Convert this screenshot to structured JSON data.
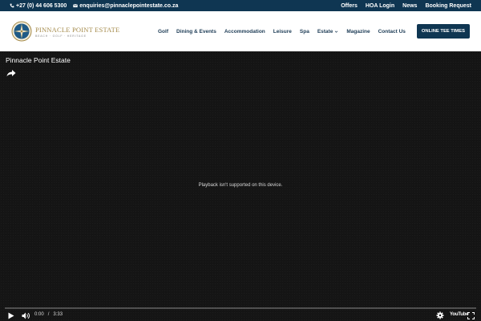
{
  "topbar": {
    "phone": "+27 (0) 44 606 5300",
    "email": "enquiries@pinnaclepointestate.co.za",
    "links": [
      "Offers",
      "HOA Login",
      "News",
      "Booking Request"
    ]
  },
  "header": {
    "logo_name": "PINNACLE POINT ESTATE",
    "logo_tagline": "BEACH · GOLF · HERITAGE",
    "nav": [
      "Golf",
      "Dining & Events",
      "Accommodation",
      "Leisure",
      "Spa",
      "Estate",
      "Magazine",
      "Contact Us"
    ],
    "cta": "ONLINE TEE TIMES"
  },
  "video": {
    "title": "Pinnacle Point Estate",
    "message": "Playback isn't supported on this device.",
    "current_time": "0:00",
    "separator": "/",
    "duration": "3:33",
    "youtube_label": "YouTube"
  },
  "colors": {
    "brand_navy": "#0f3652",
    "logo_gold": "#a48a4a",
    "nav_text": "#1c3b55"
  },
  "icons": [
    "phone-icon",
    "mail-icon",
    "chevron-down-icon",
    "share-icon",
    "play-icon",
    "volume-icon",
    "gear-icon",
    "fullscreen-icon"
  ]
}
